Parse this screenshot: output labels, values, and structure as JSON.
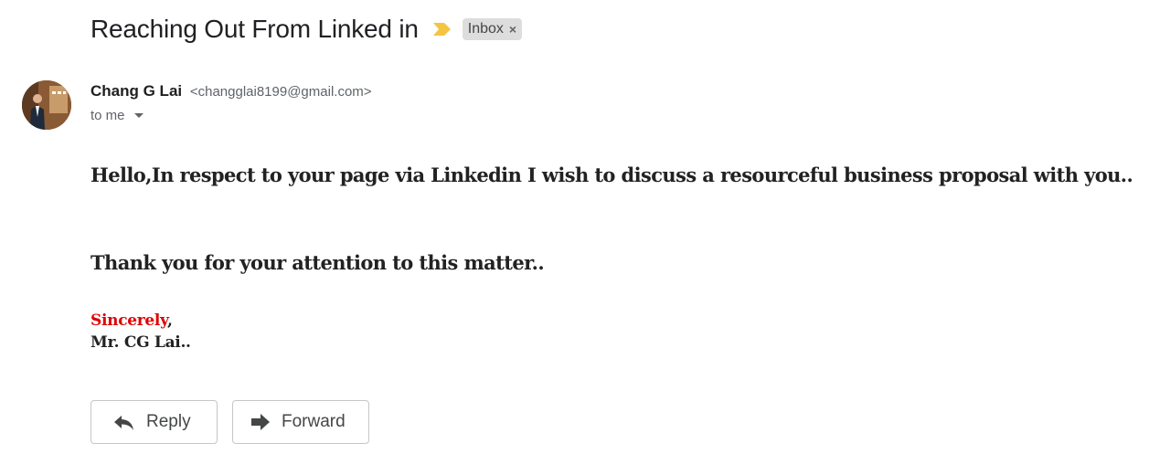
{
  "email": {
    "subject": "Reaching Out From Linked in",
    "label": "Inbox",
    "label_close": "×",
    "sender": {
      "name": "Chang G Lai",
      "email": "<changglai8199@gmail.com>"
    },
    "recipient": "to me",
    "body": {
      "paragraph_1": "Hello,In respect to your page via Linkedin I wish to discuss a resourceful business proposal with you..",
      "paragraph_2": "Thank you for your attention to this matter..",
      "closing_word": "Sincerely",
      "closing_punct": ",",
      "signature": "Mr. CG Lai.."
    }
  },
  "actions": {
    "reply_label": "Reply",
    "forward_label": "Forward"
  },
  "icons": {
    "importance": "importance-marker-icon",
    "reply": "reply-arrow-icon",
    "forward": "forward-arrow-icon",
    "details": "chevron-down-icon"
  },
  "colors": {
    "importance_marker": "#f4c542",
    "closing_highlight": "#e00000",
    "label_background": "#dddddd"
  }
}
